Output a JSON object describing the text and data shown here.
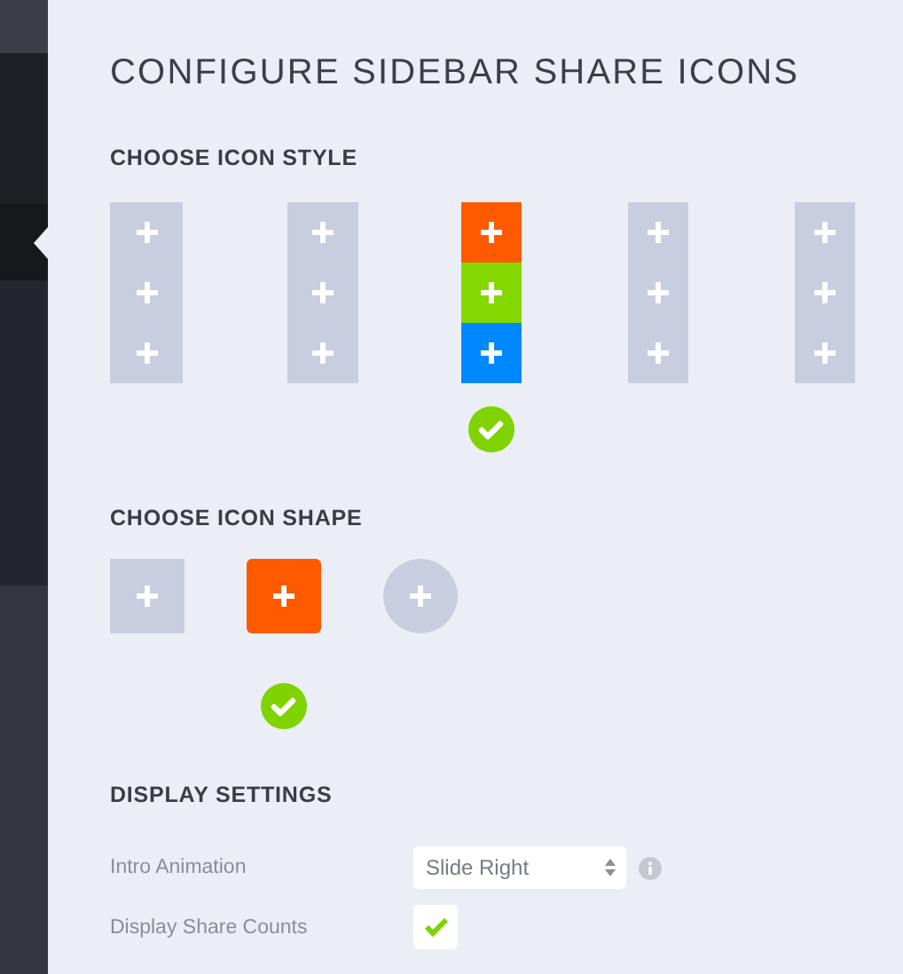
{
  "title": "CONFIGURE SIDEBAR SHARE ICONS",
  "icon_style": {
    "heading": "CHOOSE ICON STYLE",
    "options": [
      {
        "selected": false,
        "tiles": [
          {
            "color": "#c8cddf"
          },
          {
            "color": "#c8cddf"
          },
          {
            "color": "#c8cddf"
          }
        ]
      },
      {
        "selected": false,
        "tiles": [
          {
            "color": "#c8cddf"
          },
          {
            "color": "#c8cddf"
          },
          {
            "color": "#c8cddf"
          }
        ]
      },
      {
        "selected": true,
        "tiles": [
          {
            "color": "#ff5a00"
          },
          {
            "color": "#84d800"
          },
          {
            "color": "#0088ff"
          }
        ]
      },
      {
        "selected": false,
        "tiles": [
          {
            "color": "#c8cddf"
          },
          {
            "color": "#c8cddf"
          },
          {
            "color": "#c8cddf"
          }
        ]
      },
      {
        "selected": false,
        "tiles": [
          {
            "color": "#c8cddf"
          },
          {
            "color": "#c8cddf"
          },
          {
            "color": "#c8cddf"
          }
        ]
      }
    ]
  },
  "icon_shape": {
    "heading": "CHOOSE ICON SHAPE",
    "options": [
      {
        "kind": "square",
        "selected": false,
        "color": "#c8cddf"
      },
      {
        "kind": "rounded",
        "selected": true,
        "color": "#ff5a00"
      },
      {
        "kind": "circle",
        "selected": false,
        "color": "#c8cddf"
      }
    ]
  },
  "display_settings": {
    "heading": "DISPLAY SETTINGS",
    "rows": [
      {
        "kind": "select",
        "label": "Intro Animation",
        "value": "Slide Right"
      },
      {
        "kind": "checkbox",
        "label": "Display Share Counts",
        "checked": true
      }
    ]
  }
}
